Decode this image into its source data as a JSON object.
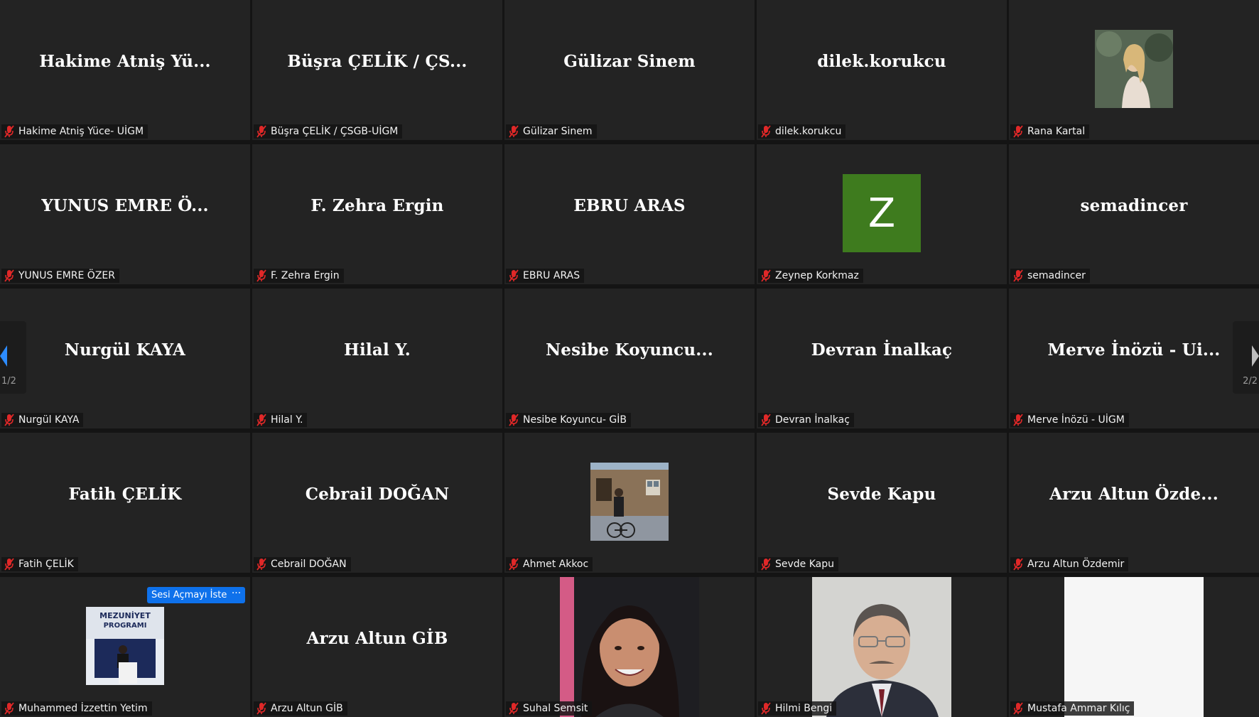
{
  "tiles": [
    {
      "big": "Hakime Atniş Yü...",
      "label": "Hakime Atniş Yüce- UİGM"
    },
    {
      "big": "Büşra ÇELİK / ÇS...",
      "label": "Büşra ÇELİK / ÇSGB-UİGM"
    },
    {
      "big": "Gülizar Sinem",
      "label": "Gülizar Sinem"
    },
    {
      "big": "dilek.korukcu",
      "label": "dilek.korukcu"
    },
    {
      "big": "",
      "label": "Rana Kartal"
    },
    {
      "big": "YUNUS EMRE Ö...",
      "label": "YUNUS EMRE ÖZER"
    },
    {
      "big": "F. Zehra Ergin",
      "label": "F. Zehra Ergin"
    },
    {
      "big": "EBRU ARAS",
      "label": "EBRU ARAS"
    },
    {
      "big": "",
      "initial": "Z",
      "label": "Zeynep Korkmaz"
    },
    {
      "big": "semadincer",
      "label": "semadincer"
    },
    {
      "big": "Nurgül KAYA",
      "label": "Nurgül KAYA"
    },
    {
      "big": "Hilal Y.",
      "label": "Hilal Y."
    },
    {
      "big": "Nesibe  Koyuncu...",
      "label": "Nesibe Koyuncu- GİB"
    },
    {
      "big": "Devran İnalkaç",
      "label": "Devran İnalkaç"
    },
    {
      "big": "Merve İnözü - Ui...",
      "label": "Merve İnözü - UİGM"
    },
    {
      "big": "Fatih ÇELİK",
      "label": "Fatih ÇELİK"
    },
    {
      "big": "Cebrail DOĞAN",
      "label": "Cebrail DOĞAN"
    },
    {
      "big": "",
      "label": "Ahmet Akkoc"
    },
    {
      "big": "Sevde Kapu",
      "label": "Sevde Kapu"
    },
    {
      "big": "Arzu Altun Özde...",
      "label": "Arzu Altun Özdemir"
    },
    {
      "big": "",
      "label": "Muhammed İzzettin Yetim"
    },
    {
      "big": "Arzu Altun GİB",
      "label": "Arzu Altun GİB"
    },
    {
      "big": "",
      "label": "Suhal Semsit"
    },
    {
      "big": "",
      "label": "Hilmi Bengi"
    },
    {
      "big": "",
      "label": "Mustafa Ammar Kılıç"
    }
  ],
  "controls": {
    "unmute_label": "Sesi Açmayı İste",
    "more_label": "···"
  },
  "pagination": {
    "left": "1/2",
    "right": "2/2"
  },
  "photo_texts": {
    "graduation_line1": "MEZUNİYET",
    "graduation_line2": "PROGRAMI"
  },
  "colors": {
    "tile_bg": "#232323",
    "avatar_green": "#3e7b1e",
    "button_blue": "#0e71eb",
    "muted_red": "#e02828"
  }
}
